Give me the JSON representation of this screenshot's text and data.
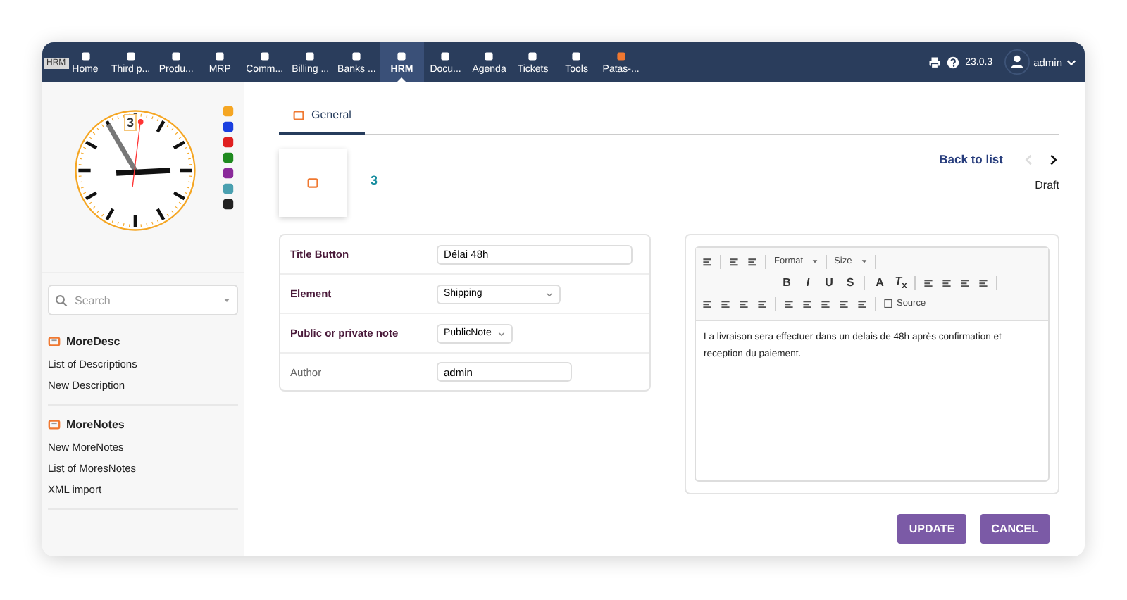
{
  "topbar": {
    "tooltip": "HRM",
    "modules": [
      {
        "label": "Home",
        "selected": false,
        "color": "#ffffff"
      },
      {
        "label": "Third p...",
        "selected": false,
        "color": "#ffffff"
      },
      {
        "label": "Produ...",
        "selected": false,
        "color": "#ffffff"
      },
      {
        "label": "MRP",
        "selected": false,
        "color": "#ffffff"
      },
      {
        "label": "Comm...",
        "selected": false,
        "color": "#ffffff"
      },
      {
        "label": "Billing ...",
        "selected": false,
        "color": "#ffffff"
      },
      {
        "label": "Banks ...",
        "selected": false,
        "color": "#ffffff"
      },
      {
        "label": "HRM",
        "selected": true,
        "color": "#ffffff"
      },
      {
        "label": "Docu...",
        "selected": false,
        "color": "#ffffff"
      },
      {
        "label": "Agenda",
        "selected": false,
        "color": "#ffffff"
      },
      {
        "label": "Tickets",
        "selected": false,
        "color": "#ffffff"
      },
      {
        "label": "Tools",
        "selected": false,
        "color": "#ffffff"
      },
      {
        "label": "Patas-...",
        "selected": false,
        "color": "#f07830"
      }
    ],
    "version": "23.0.3",
    "user": "admin"
  },
  "sidebar": {
    "clock_date": "3",
    "quick_icons": [
      {
        "color": "#f5a623"
      },
      {
        "color": "#1a3fe0"
      },
      {
        "color": "#e02020"
      },
      {
        "color": "#1f8a1f"
      },
      {
        "color": "#8a2a9a"
      },
      {
        "color": "#4aa0b0"
      },
      {
        "color": "#222222"
      }
    ],
    "search": {
      "placeholder": "Search"
    },
    "sections": [
      {
        "title": "MoreDesc",
        "items": [
          "List of Descriptions",
          "New Description"
        ]
      },
      {
        "title": "MoreNotes",
        "items": [
          "New MoreNotes",
          "List of MoresNotes",
          "XML import"
        ]
      }
    ]
  },
  "tabs": [
    {
      "label": "General",
      "selected": true
    }
  ],
  "record": {
    "ref": "3",
    "back_link": "Back to list",
    "prev_disabled": true,
    "next_disabled": false,
    "status": "Draft"
  },
  "form": [
    {
      "label": "Title Button",
      "required": true,
      "kind": "text",
      "value": "Délai 48h"
    },
    {
      "label": "Element",
      "required": true,
      "kind": "select",
      "value": "Shipping"
    },
    {
      "label": "Public or private note",
      "required": true,
      "kind": "select",
      "value": "PublicNote"
    },
    {
      "label": "Author",
      "required": false,
      "kind": "text",
      "value": "admin"
    }
  ],
  "editor": {
    "toolbar": [
      [
        {
          "kind": "icon"
        },
        {
          "kind": "sep"
        },
        {
          "kind": "icon"
        },
        {
          "kind": "icon"
        },
        {
          "kind": "sep"
        },
        {
          "kind": "dropdown",
          "label": "Format"
        },
        {
          "kind": "sep"
        },
        {
          "kind": "dropdown",
          "label": "Size"
        },
        {
          "kind": "sep"
        }
      ],
      [
        {
          "kind": "glyph",
          "label": "B"
        },
        {
          "kind": "glyph",
          "label": "*I*"
        },
        {
          "kind": "glyph",
          "label": "U"
        },
        {
          "kind": "glyph",
          "label": "S"
        },
        {
          "kind": "sep"
        },
        {
          "kind": "glyph",
          "label": "A"
        },
        {
          "kind": "glyph",
          "label": "*T*$_{x}$"
        },
        {
          "kind": "sep"
        },
        {
          "kind": "icon"
        },
        {
          "kind": "icon"
        },
        {
          "kind": "icon"
        },
        {
          "kind": "icon"
        },
        {
          "kind": "sep"
        }
      ],
      [
        {
          "kind": "icon"
        },
        {
          "kind": "icon"
        },
        {
          "kind": "icon"
        },
        {
          "kind": "icon"
        },
        {
          "kind": "sep"
        },
        {
          "kind": "icon"
        },
        {
          "kind": "icon"
        },
        {
          "kind": "icon"
        },
        {
          "kind": "icon"
        },
        {
          "kind": "icon"
        },
        {
          "kind": "sep"
        },
        {
          "kind": "text",
          "label": "Source"
        }
      ]
    ],
    "content": "La livraison sera effectuer dans un delais de 48h après confirmation et reception du paiement."
  },
  "buttons": [
    "UPDATE",
    "CANCEL"
  ]
}
